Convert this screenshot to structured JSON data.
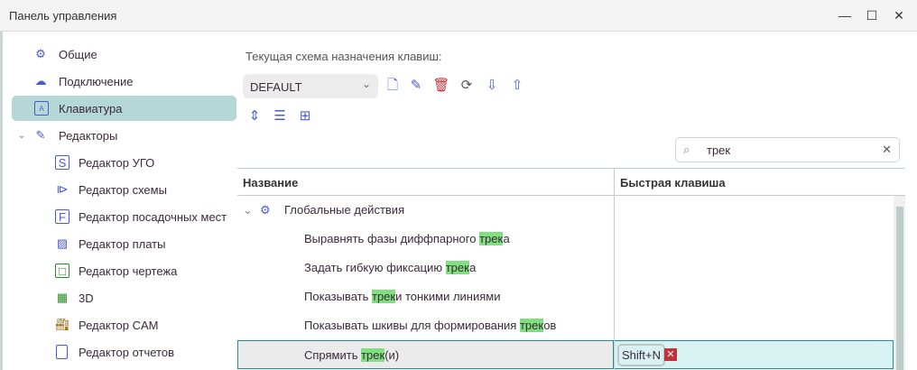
{
  "window": {
    "title": "Панель управления"
  },
  "sidebar": {
    "items": [
      {
        "label": "Общие",
        "icon": "gear-icon"
      },
      {
        "label": "Подключение",
        "icon": "cloud-icon"
      },
      {
        "label": "Клавиатура",
        "icon": "keyboard-icon",
        "selected": true
      },
      {
        "label": "Редакторы",
        "icon": "pencil-icon",
        "expanded": true
      },
      {
        "label": "Редактор УГО",
        "icon": "s-box-icon"
      },
      {
        "label": "Редактор схемы",
        "icon": "schematic-icon"
      },
      {
        "label": "Редактор посадочных мест",
        "icon": "f-box-icon"
      },
      {
        "label": "Редактор платы",
        "icon": "board-icon"
      },
      {
        "label": "Редактор чертежа",
        "icon": "chip-icon"
      },
      {
        "label": "3D",
        "icon": "3d-icon"
      },
      {
        "label": "Редактор CAM",
        "icon": "factory-icon"
      },
      {
        "label": "Редактор отчетов",
        "icon": "report-icon"
      }
    ]
  },
  "main": {
    "scheme_label": "Текущая схема назначения клавиш:",
    "scheme_value": "DEFAULT",
    "search_value": "трек",
    "columns": [
      "Название",
      "Быстрая клавиша"
    ],
    "group": "Глобальные действия",
    "rows": [
      {
        "pre": "Выравнять фазы диффпарного ",
        "match": "трек",
        "post": "а",
        "shortcut": ""
      },
      {
        "pre": "Задать гибкую фиксацию ",
        "match": "трек",
        "post": "а",
        "shortcut": ""
      },
      {
        "pre": "Показывать ",
        "match": "трек",
        "post": "и тонкими линиями",
        "shortcut": ""
      },
      {
        "pre": "Показывать шкивы для формирования ",
        "match": "трек",
        "post": "ов",
        "shortcut": ""
      },
      {
        "pre": "Спрямить ",
        "match": "трек",
        "post": "(и)",
        "shortcut": "Shift+N",
        "selected": true
      }
    ]
  },
  "colors": {
    "accent": "#b5d8d6",
    "highlight": "#7fe07f",
    "icon": "#4a5bd0",
    "selected_row": "#d8f1f1"
  }
}
